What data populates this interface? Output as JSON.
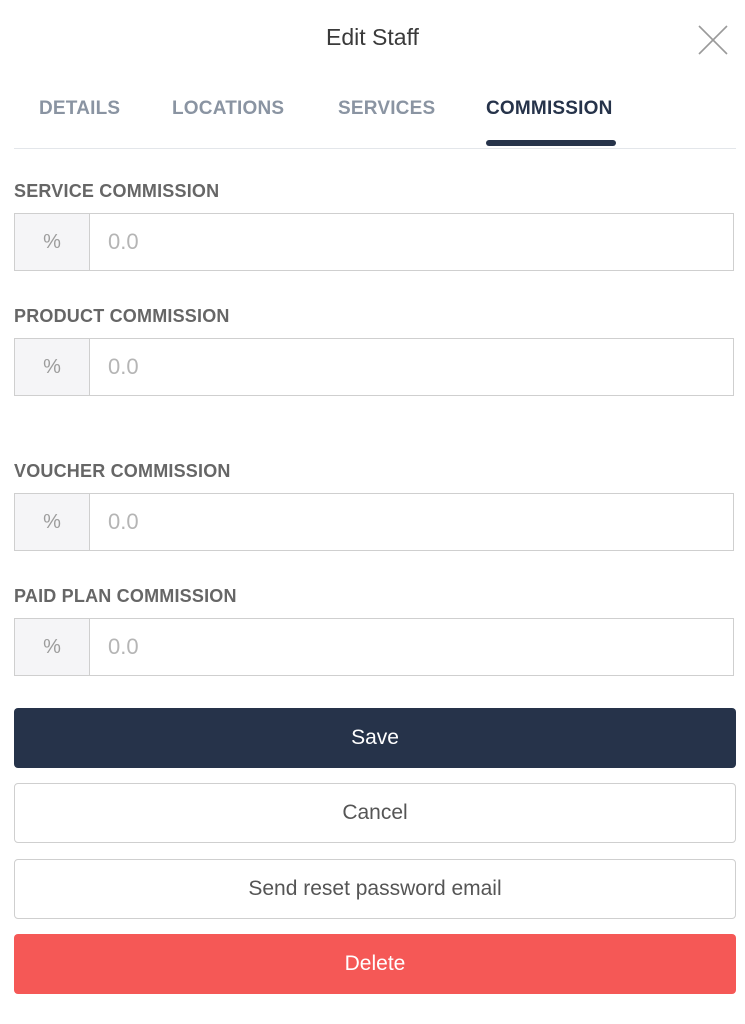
{
  "header": {
    "title": "Edit Staff",
    "close_icon": "close-icon"
  },
  "tabs": [
    {
      "label": "DETAILS",
      "active": false
    },
    {
      "label": "LOCATIONS",
      "active": false
    },
    {
      "label": "SERVICES",
      "active": false
    },
    {
      "label": "COMMISSION",
      "active": true
    }
  ],
  "fields": [
    {
      "label": "SERVICE COMMISSION",
      "addon": "%",
      "value": "",
      "placeholder": "0.0"
    },
    {
      "label": "PRODUCT COMMISSION",
      "addon": "%",
      "value": "",
      "placeholder": "0.0"
    },
    {
      "label": "VOUCHER COMMISSION",
      "addon": "%",
      "value": "",
      "placeholder": "0.0"
    },
    {
      "label": "PAID PLAN COMMISSION",
      "addon": "%",
      "value": "",
      "placeholder": "0.0"
    }
  ],
  "buttons": {
    "save": "Save",
    "cancel": "Cancel",
    "reset_password": "Send reset password email",
    "delete": "Delete"
  },
  "colors": {
    "primary": "#26334a",
    "danger": "#f55856",
    "tab_inactive": "#8a94a2"
  }
}
